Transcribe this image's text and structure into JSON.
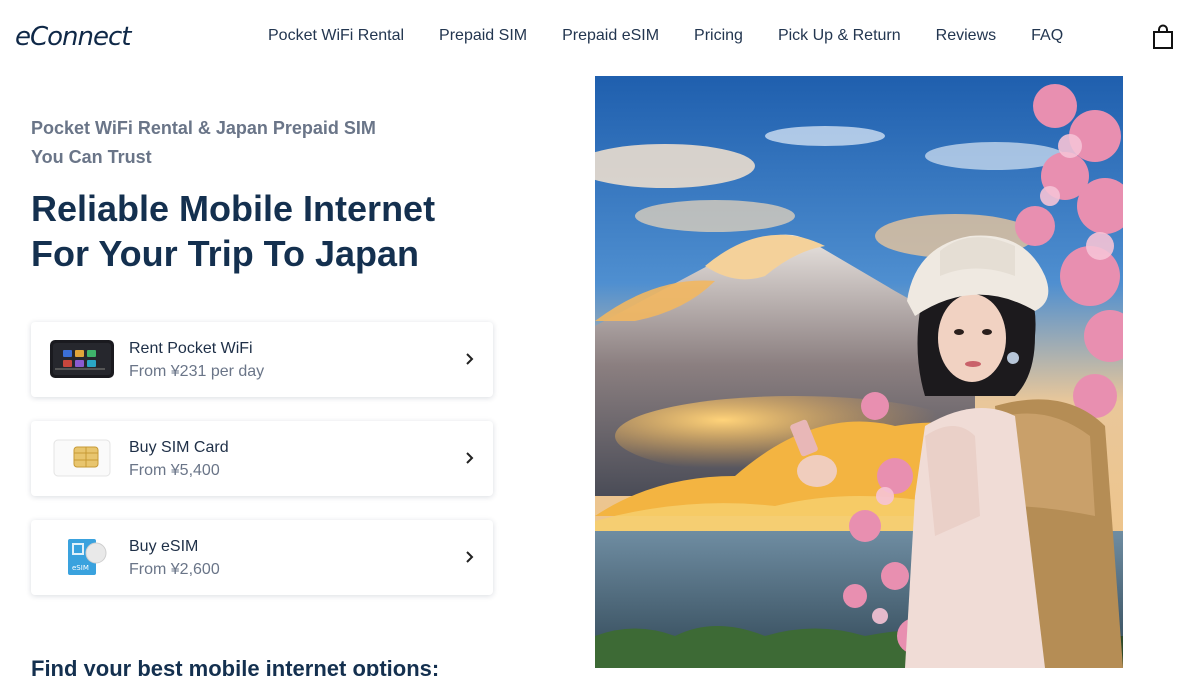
{
  "brand": {
    "logo_text": "eConnect"
  },
  "nav": {
    "items": [
      {
        "label": "Pocket WiFi Rental"
      },
      {
        "label": "Prepaid SIM"
      },
      {
        "label": "Prepaid eSIM"
      },
      {
        "label": "Pricing"
      },
      {
        "label": "Pick Up & Return"
      },
      {
        "label": "Reviews"
      },
      {
        "label": "FAQ"
      }
    ],
    "cart_icon": "shopping-bag-icon"
  },
  "hero": {
    "kicker_line1": "Pocket WiFi Rental & Japan Prepaid SIM",
    "kicker_line2": "You Can Trust",
    "headline_line1": "Reliable Mobile Internet",
    "headline_line2": "For Your Trip To Japan"
  },
  "products": [
    {
      "title": "Rent Pocket WiFi",
      "price": "From ¥231 per day",
      "icon": "pocket-wifi-device-icon"
    },
    {
      "title": "Buy SIM Card",
      "price": "From ¥5,400",
      "icon": "sim-card-icon"
    },
    {
      "title": "Buy eSIM",
      "price": "From ¥2,600",
      "icon": "esim-card-icon"
    }
  ],
  "esim_badge_text": "eSIM",
  "section": {
    "title": "Find your best mobile internet options:"
  },
  "colors": {
    "primary": "#14304f",
    "muted": "#6a7588",
    "accent_sky": "#2f6fb8",
    "blossom": "#e88fb0"
  }
}
